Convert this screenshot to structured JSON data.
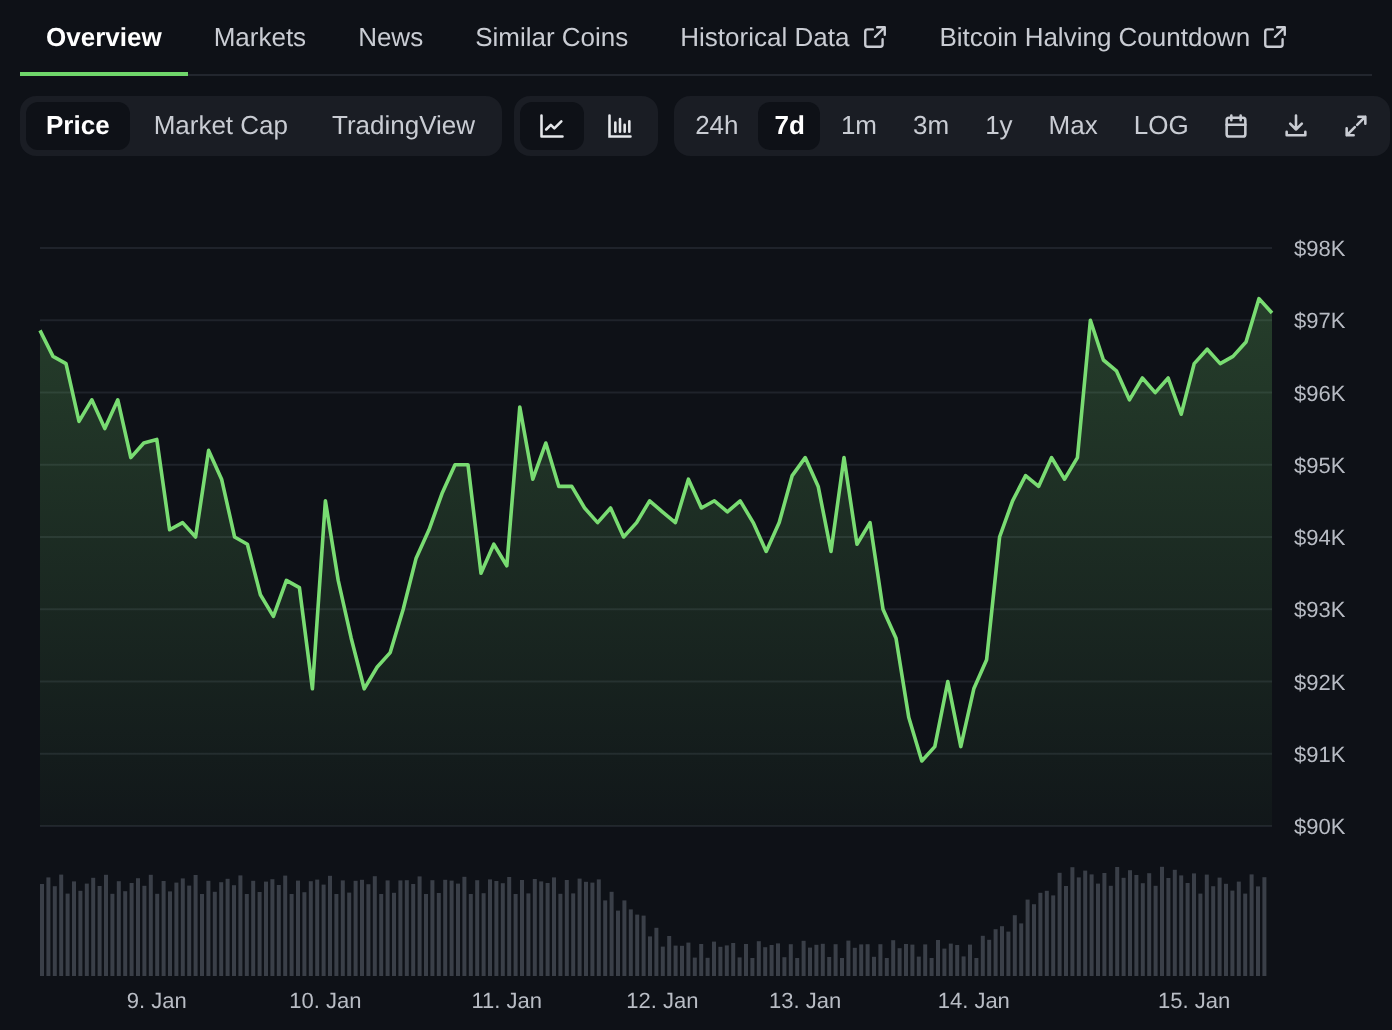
{
  "tabs": [
    {
      "label": "Overview",
      "selected": true,
      "external": false
    },
    {
      "label": "Markets",
      "selected": false,
      "external": false
    },
    {
      "label": "News",
      "selected": false,
      "external": false
    },
    {
      "label": "Similar Coins",
      "selected": false,
      "external": false
    },
    {
      "label": "Historical Data",
      "selected": false,
      "external": true
    },
    {
      "label": "Bitcoin Halving Countdown",
      "selected": false,
      "external": true
    }
  ],
  "chart_types": [
    {
      "label": "Price",
      "selected": true
    },
    {
      "label": "Market Cap",
      "selected": false
    },
    {
      "label": "TradingView",
      "selected": false
    }
  ],
  "chart_styles": [
    {
      "kind": "line",
      "selected": true
    },
    {
      "kind": "bar",
      "selected": false
    }
  ],
  "ranges": [
    {
      "label": "24h",
      "selected": false
    },
    {
      "label": "7d",
      "selected": true
    },
    {
      "label": "1m",
      "selected": false
    },
    {
      "label": "3m",
      "selected": false
    },
    {
      "label": "1y",
      "selected": false
    },
    {
      "label": "Max",
      "selected": false
    },
    {
      "label": "LOG",
      "selected": false
    }
  ],
  "chart_data": {
    "type": "area",
    "grid": true,
    "ylim": [
      90000,
      98000
    ],
    "categories": [
      null,
      null,
      null,
      null,
      null,
      null,
      null,
      null,
      null,
      "9. Jan",
      null,
      null,
      null,
      null,
      null,
      null,
      null,
      null,
      null,
      null,
      null,
      null,
      "10. Jan",
      null,
      null,
      null,
      null,
      null,
      null,
      null,
      null,
      null,
      null,
      null,
      null,
      null,
      "11. Jan",
      null,
      null,
      null,
      null,
      null,
      null,
      null,
      null,
      null,
      null,
      null,
      "12. Jan",
      null,
      null,
      null,
      null,
      null,
      null,
      null,
      null,
      null,
      null,
      "13. Jan",
      null,
      null,
      null,
      null,
      null,
      null,
      null,
      null,
      null,
      null,
      null,
      null,
      "14. Jan",
      null,
      null,
      null,
      null,
      null,
      null,
      null,
      null,
      null,
      null,
      null,
      null,
      null,
      null,
      null,
      null,
      "15. Jan",
      null,
      null,
      null,
      null,
      null,
      null
    ],
    "yticks": [
      {
        "value": 90000,
        "label": "$90K"
      },
      {
        "value": 91000,
        "label": "$91K"
      },
      {
        "value": 92000,
        "label": "$92K"
      },
      {
        "value": 93000,
        "label": "$93K"
      },
      {
        "value": 94000,
        "label": "$94K"
      },
      {
        "value": 95000,
        "label": "$95K"
      },
      {
        "value": 96000,
        "label": "$96K"
      },
      {
        "value": 97000,
        "label": "$97K"
      },
      {
        "value": 98000,
        "label": "$98K"
      }
    ],
    "series": [
      {
        "color": "#79dc72",
        "values": [
          96860,
          96500,
          96400,
          95600,
          95900,
          95500,
          95900,
          95100,
          95300,
          95350,
          94100,
          94200,
          94000,
          95200,
          94800,
          94000,
          93900,
          93200,
          92900,
          93400,
          93300,
          91900,
          94500,
          93400,
          92600,
          91900,
          92200,
          92400,
          93000,
          93700,
          94100,
          94600,
          95000,
          95000,
          93500,
          93900,
          93600,
          95800,
          94800,
          95300,
          94700,
          94700,
          94400,
          94200,
          94400,
          94000,
          94200,
          94500,
          94350,
          94200,
          94800,
          94400,
          94500,
          94350,
          94500,
          94200,
          93800,
          94200,
          94850,
          95100,
          94700,
          93800,
          95100,
          93900,
          94200,
          93000,
          92600,
          91500,
          90900,
          91100,
          92000,
          91100,
          91900,
          92300,
          94000,
          94500,
          94850,
          94700,
          95100,
          94800,
          95100,
          97000,
          96450,
          96300,
          95900,
          96200,
          96000,
          96200,
          95700,
          96400,
          96600,
          96400,
          96500,
          96700,
          97300,
          97100
        ]
      }
    ]
  }
}
